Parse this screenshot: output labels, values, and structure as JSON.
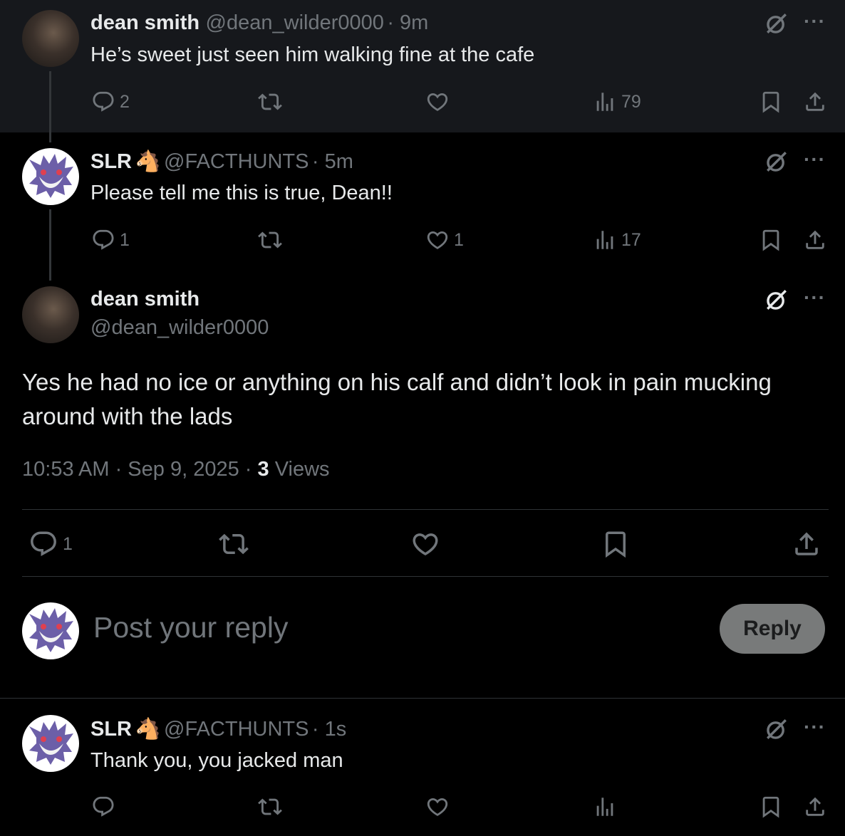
{
  "posts": [
    {
      "name": "dean smith",
      "handle": "@dean_wilder0000",
      "time": "· 9m",
      "text": "He’s sweet just seen him walking fine at the cafe",
      "replies": "2",
      "likes": "",
      "views": "79"
    },
    {
      "name": "SLR",
      "emoji": "🐴",
      "handle": "@FACTHUNTS",
      "time": "· 5m",
      "text": "Please tell me this is true, Dean!!",
      "replies": "1",
      "likes": "1",
      "views": "17"
    }
  ],
  "focused": {
    "name": "dean smith",
    "handle": "@dean_wilder0000",
    "text": "Yes he had no ice or anything on his calf and didn’t look in pain mucking around with the lads",
    "timestamp": "10:53 AM · Sep 9, 2025 ·",
    "views_count": "3",
    "views_label": "Views",
    "replies": "1"
  },
  "composer": {
    "placeholder": "Post your reply",
    "button": "Reply"
  },
  "reply": {
    "name": "SLR",
    "emoji": "🐴",
    "handle": "@FACTHUNTS",
    "time": "· 1s",
    "text": "Thank you, you jacked man"
  },
  "icons": {
    "reply": "reply-icon",
    "repost": "repost-icon",
    "like": "heart-icon",
    "views": "analytics-icon",
    "bookmark": "bookmark-icon",
    "share": "share-icon",
    "grok": "grok-icon",
    "more": "more-icon"
  },
  "colors": {
    "background": "#000000",
    "highlight_bg": "#16181c",
    "text": "#e7e9ea",
    "muted": "#71767b",
    "reply_button": "#787a7a"
  }
}
